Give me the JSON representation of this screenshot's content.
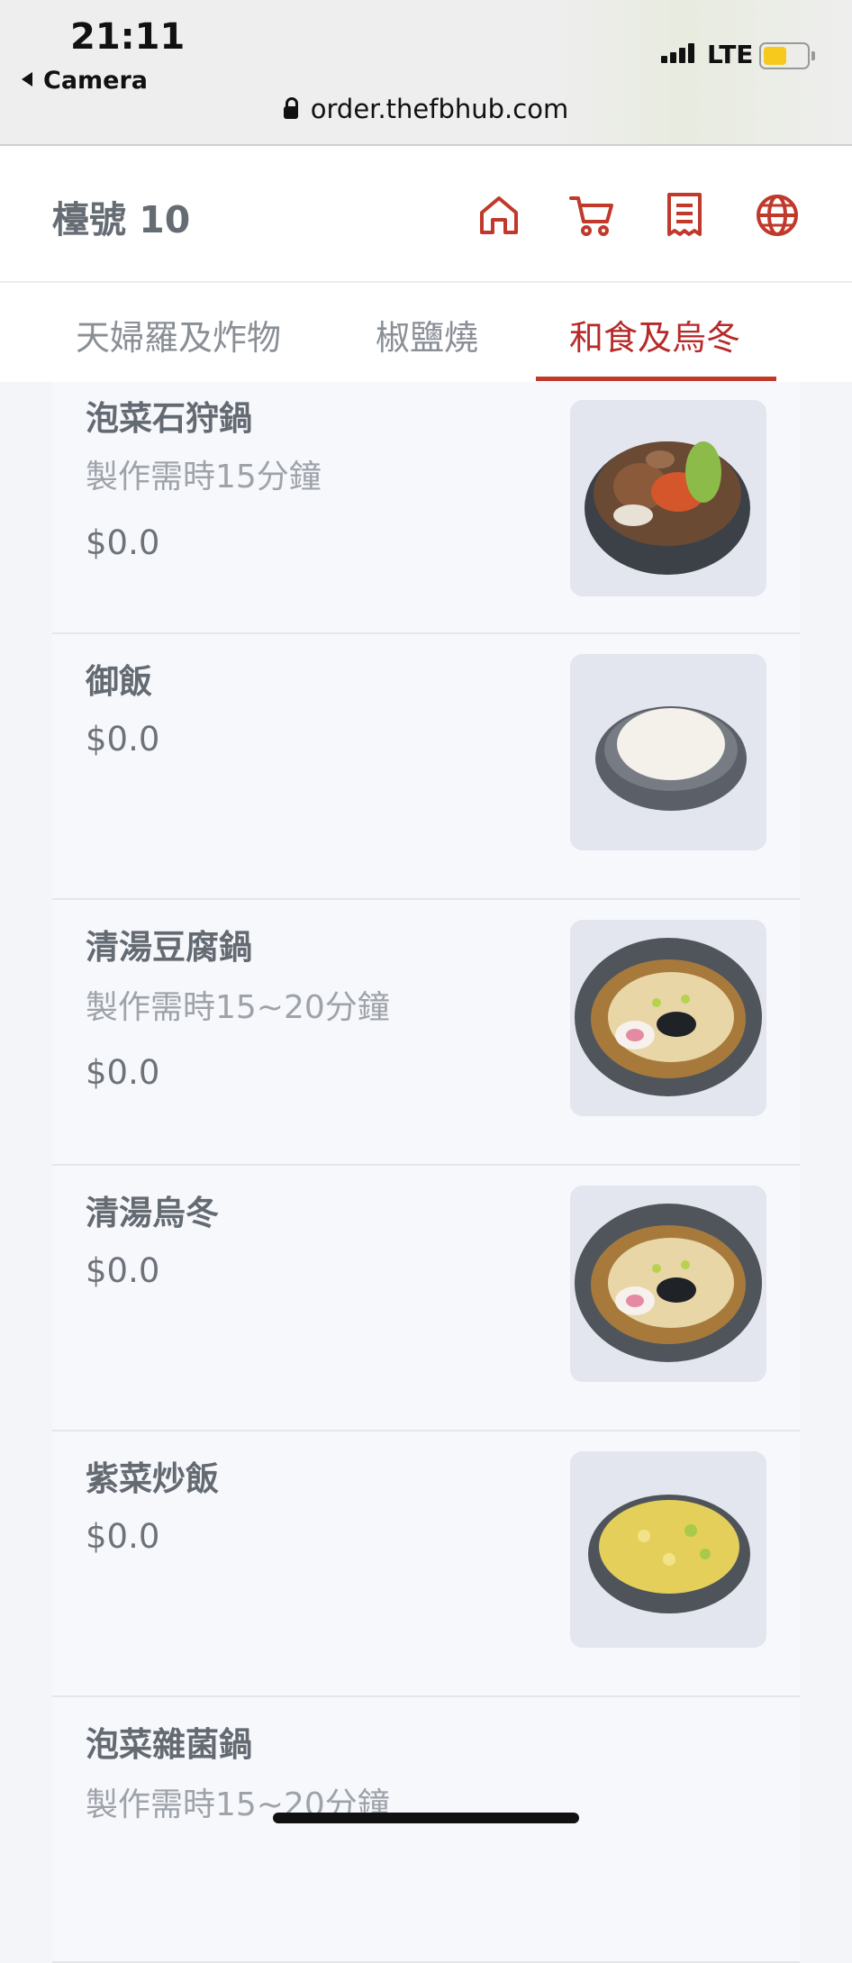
{
  "status_bar": {
    "time": "21:11",
    "back_label": "Camera",
    "network": "LTE",
    "battery_level": 0.55,
    "battery_color": "#f7c91c"
  },
  "browser": {
    "url": "order.thefbhub.com"
  },
  "header": {
    "table_label": "檯號 10",
    "accent_color": "#c0392b",
    "icons": [
      "home-icon",
      "cart-icon",
      "receipt-icon",
      "globe-icon"
    ]
  },
  "tabs": [
    {
      "label": "天婦羅及炸物",
      "active": false
    },
    {
      "label": "椒鹽燒",
      "active": false
    },
    {
      "label": "和食及烏冬",
      "active": true
    }
  ],
  "menu_items": [
    {
      "name": "泡菜石狩鍋",
      "note": "製作需時15分鐘",
      "price": "$0.0",
      "image": "hotpot-photo"
    },
    {
      "name": "御飯",
      "note": "",
      "price": "$0.0",
      "image": "rice-photo"
    },
    {
      "name": "清湯豆腐鍋",
      "note": "製作需時15~20分鐘",
      "price": "$0.0",
      "image": "udon-photo"
    },
    {
      "name": "清湯烏冬",
      "note": "",
      "price": "$0.0",
      "image": "udon-photo"
    },
    {
      "name": "紫菜炒飯",
      "note": "",
      "price": "$0.0",
      "image": "fried-rice-photo"
    },
    {
      "name": "泡菜雜菌鍋",
      "note": "製作需時15~20分鐘",
      "price": "",
      "image": ""
    }
  ]
}
